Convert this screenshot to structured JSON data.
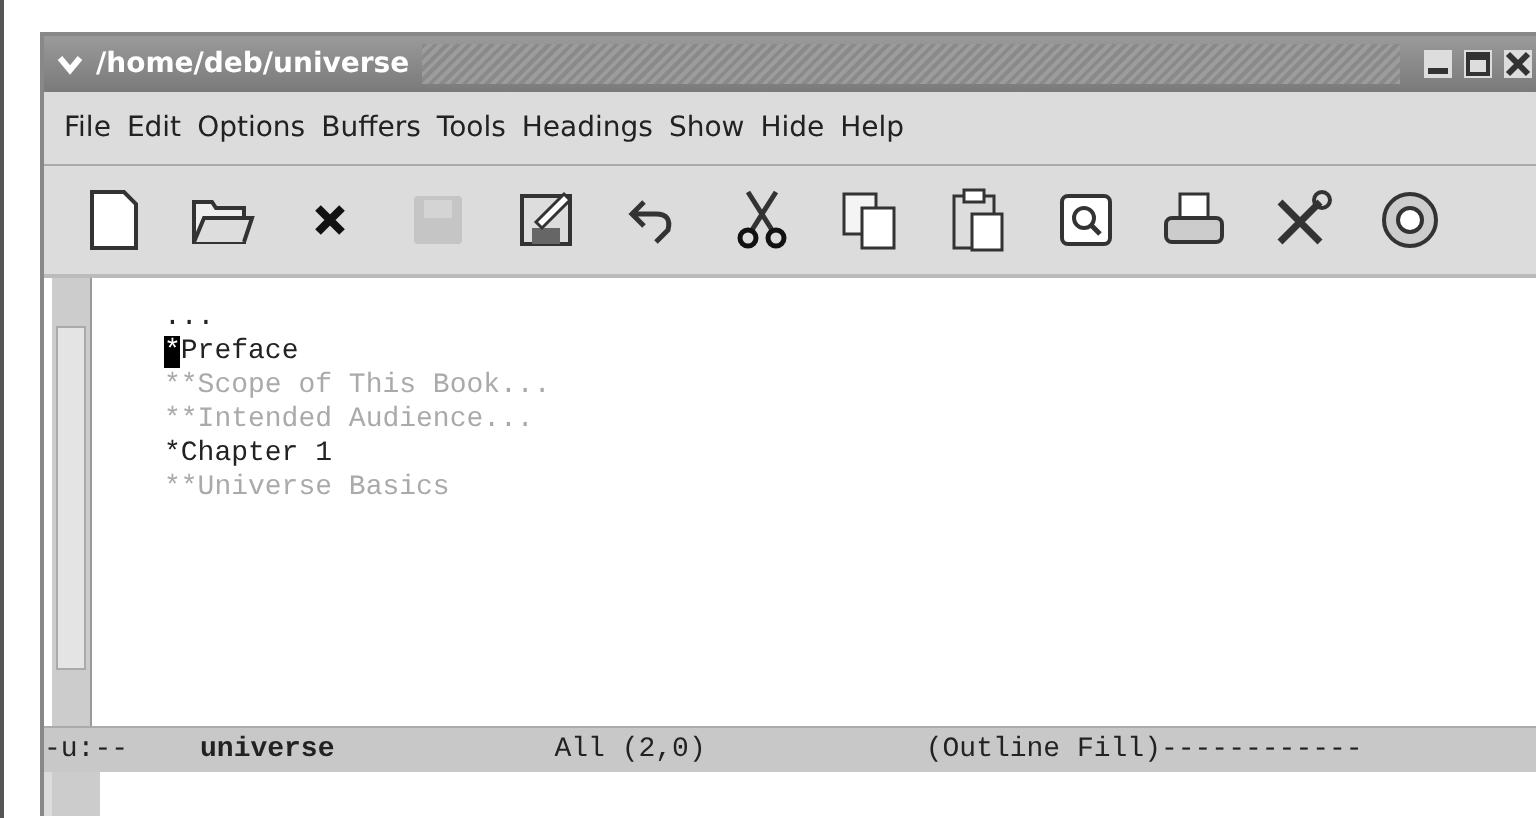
{
  "window": {
    "title": "/home/deb/universe"
  },
  "menu": [
    "File",
    "Edit",
    "Options",
    "Buffers",
    "Tools",
    "Headings",
    "Show",
    "Hide",
    "Help"
  ],
  "toolbar": [
    {
      "kind": "new",
      "disabled": false
    },
    {
      "kind": "open",
      "disabled": false
    },
    {
      "kind": "close",
      "disabled": false
    },
    {
      "kind": "save",
      "disabled": true
    },
    {
      "kind": "saveas",
      "disabled": false
    },
    {
      "kind": "undo",
      "disabled": false
    },
    {
      "kind": "cut",
      "disabled": false
    },
    {
      "kind": "copy",
      "disabled": false
    },
    {
      "kind": "paste",
      "disabled": false
    },
    {
      "kind": "search",
      "disabled": false
    },
    {
      "kind": "print",
      "disabled": false
    },
    {
      "kind": "tools",
      "disabled": false
    },
    {
      "kind": "help",
      "disabled": false
    }
  ],
  "buffer_lines": [
    {
      "text": "...",
      "dimmed": false,
      "cursor": false
    },
    {
      "text": "*Preface",
      "dimmed": false,
      "cursor": true
    },
    {
      "text": "**Scope of This Book...",
      "dimmed": true,
      "cursor": false
    },
    {
      "text": "**Intended Audience...",
      "dimmed": true,
      "cursor": false
    },
    {
      "text": "*Chapter 1",
      "dimmed": false,
      "cursor": false
    },
    {
      "text": "**Universe Basics",
      "dimmed": true,
      "cursor": false
    }
  ],
  "mode_line": {
    "status": "-u:--",
    "buffer_name": "universe",
    "position": "All (2,0)",
    "modes": "(Outline Fill)------------"
  }
}
